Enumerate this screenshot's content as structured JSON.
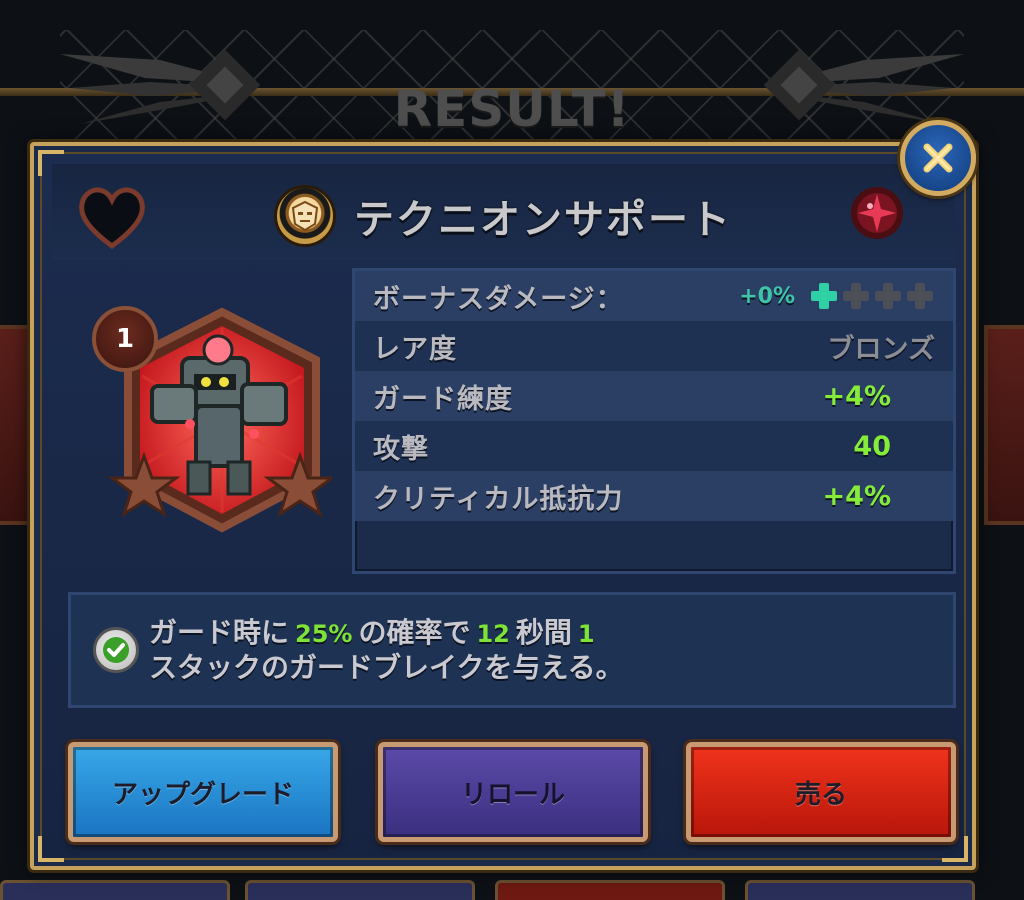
{
  "screen": {
    "background_title": "RESULT!"
  },
  "card": {
    "title": "テクニオンサポート",
    "level": "1",
    "stars": 2,
    "close_icon": "close-x-icon",
    "favorite_icon": "heart-outline-icon",
    "element_icon": "red-gem-icon",
    "emblem_icon": "mask-emblem-icon"
  },
  "stats": {
    "bonus_damage": {
      "label": "ボーナスダメージ：",
      "value": "+0%",
      "upgrades_total": 4,
      "upgrades_active": 1
    },
    "rarity": {
      "label": "レア度",
      "value": "ブロンズ"
    },
    "guard_mastery": {
      "label": "ガード練度",
      "value": "+4%"
    },
    "attack": {
      "label": "攻撃",
      "value": "40"
    },
    "crit_resist": {
      "label": "クリティカル抵抗力",
      "value": "+4%"
    }
  },
  "skill": {
    "line1_a": "ガード時に",
    "chance": "25%",
    "line1_b": "の確率で",
    "seconds": "12",
    "line1_c": "秒間",
    "stacks": "1",
    "line2": "スタックのガードブレイクを与える。"
  },
  "buttons": {
    "upgrade": "アップグレード",
    "reroll": "リロール",
    "sell": "売る"
  },
  "colors": {
    "accent_gold": "#c7a25b",
    "value_green": "#86ec3a",
    "bonus_teal": "#2fd0a6",
    "upgrade_blue": "#1a74c2",
    "reroll_purple": "#3a2f80",
    "sell_red": "#b8160a"
  }
}
